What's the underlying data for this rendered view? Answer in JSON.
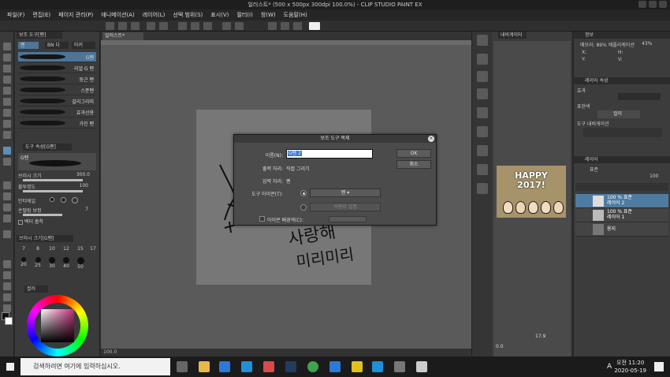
{
  "window": {
    "title": "일러스트* (500 x 500px 300dpi 100.0%) - CLIP STUDIO PAINT EX"
  },
  "menu": [
    "파일(F)",
    "편집(E)",
    "페이지 관리(P)",
    "애니메이션(A)",
    "레이어(L)",
    "선택 범위(S)",
    "표시(V)",
    "필터(I)",
    "창(W)",
    "도움말(H)"
  ],
  "subtool": {
    "title": "보조 도구[펜]",
    "tabs": [
      "펜",
      "BN 다",
      "마커"
    ],
    "brushes": [
      "G펜",
      "리얼 G 펜",
      "둥근 펜",
      "스푼펜",
      "갈리그라피",
      "효과선용",
      "가진 펜"
    ],
    "selected_brush": "G펜"
  },
  "tool_property": {
    "title": "도구 속성[G펜]",
    "tool_name": "G펜",
    "brush_size_label": "브러시 크기",
    "brush_size_value": "300.0",
    "opacity_label": "불투명도",
    "opacity_value": "100",
    "antialias_label": "안티에일",
    "stabilization_label": "손떨림 보정",
    "stabilization_value": "7",
    "vector_label": "벡터 흡착"
  },
  "brush_size_panel": {
    "title": "브러시 크기[G펜]",
    "sizes": [
      "7",
      "8",
      "10",
      "12",
      "15",
      "17",
      "20",
      "25",
      "30",
      "40",
      "50"
    ]
  },
  "color_panel": {
    "title": "컬러",
    "fg": "#111111",
    "bg": "#ffffff"
  },
  "canvas": {
    "tab": "일러스트*",
    "status_zoom": "100.0",
    "handwriting": [
      "사랑해",
      "미리미리"
    ]
  },
  "navigator": {
    "title": "내비게이터",
    "zoom": "17.9",
    "angle": "0.0"
  },
  "happy_image": {
    "line1": "HAPPY",
    "line2": "2017!"
  },
  "info_panel": {
    "title": "정보",
    "memory": "메모리: 89% 애플리케이션",
    "memory_value": "43%",
    "rgb": [
      "X:",
      "Y:",
      "H:",
      "V:"
    ]
  },
  "layer_property": {
    "title": "레이어 속성",
    "effect_label": "효과",
    "display_color_label": "표현색",
    "display_color_value": "컬러",
    "tool_nav_label": "도구 내비게이션"
  },
  "layer_panel": {
    "title": "레이어",
    "blend": "표준",
    "opacity": "100",
    "layers": [
      {
        "meta": "100 % 표준",
        "name": "레이어 2",
        "selected": true
      },
      {
        "meta": "100 % 표준",
        "name": "레이어 1",
        "selected": false
      },
      {
        "meta": "",
        "name": "용지",
        "selected": false
      }
    ]
  },
  "dialog": {
    "title": "보조 도구 복제",
    "name_label": "이름(N):",
    "name_value": "G펜 2",
    "output_label": "출력 처리:",
    "output_value": "직접 그리기",
    "input_label": "입력 처리:",
    "input_value": "펜",
    "tool_icon_label": "도구 아이콘(T):",
    "icon_value": "펜",
    "custom_icon_label": "사용자 설정",
    "bgcolor_label": "아이콘 배경색(C):",
    "ok": "OK",
    "cancel": "취소"
  },
  "taskbar": {
    "search_placeholder": "검색하려면 여기에 입력하십시오.",
    "time": "오전 11:20",
    "date": "2020-05-19",
    "lang": "A"
  }
}
